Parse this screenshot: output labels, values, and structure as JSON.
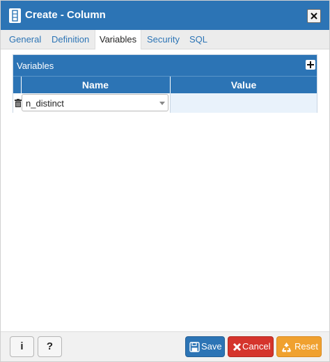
{
  "window": {
    "title": "Create - Column",
    "icon": "column-icon",
    "close_icon": "close-icon"
  },
  "tabs": [
    {
      "label": "General",
      "active": false
    },
    {
      "label": "Definition",
      "active": false
    },
    {
      "label": "Variables",
      "active": true
    },
    {
      "label": "Security",
      "active": false
    },
    {
      "label": "SQL",
      "active": false
    }
  ],
  "variables_grid": {
    "title": "Variables",
    "add_icon": "plus-icon",
    "columns": [
      "Name",
      "Value"
    ],
    "rows": [
      {
        "name": "n_distinct",
        "value": "",
        "delete_icon": "trash-icon"
      }
    ]
  },
  "footer": {
    "info_label": "i",
    "help_label": "?",
    "save_label": "Save",
    "cancel_label": "Cancel",
    "reset_label": "Reset"
  },
  "colors": {
    "primary": "#2c74b5",
    "danger": "#d5342c",
    "warning": "#f0a12f",
    "value_cell": "#e9f2fb"
  }
}
